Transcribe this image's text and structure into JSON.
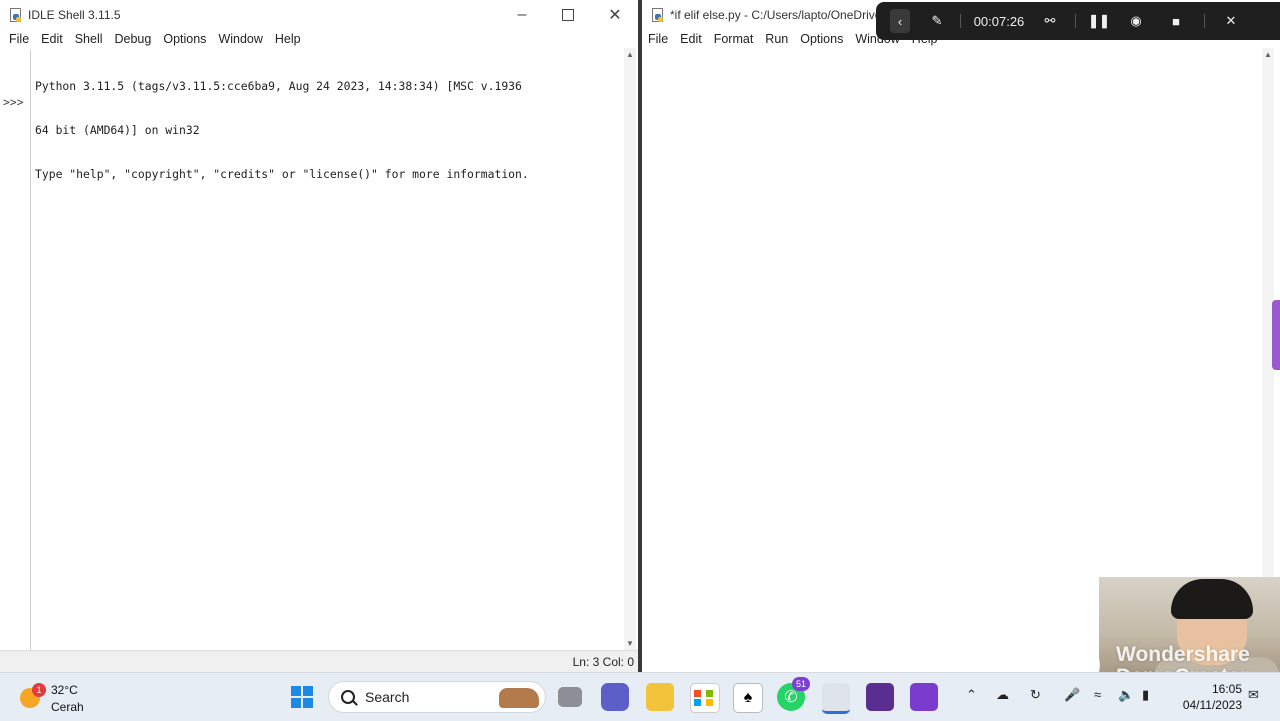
{
  "shell_window": {
    "title": "IDLE Shell 3.11.5",
    "menu": [
      "File",
      "Edit",
      "Shell",
      "Debug",
      "Options",
      "Window",
      "Help"
    ],
    "prompt": ">>>",
    "banner": [
      "Python 3.11.5 (tags/v3.11.5:cce6ba9, Aug 24 2023, 14:38:34) [MSC v.1936",
      "64 bit (AMD64)] on win32",
      "Type \"help\", \"copyright\", \"credits\" or \"license()\" for more information."
    ],
    "status": "Ln: 3   Col: 0",
    "controls": {
      "minimize": "minimize-icon",
      "maximize": "maximize-icon",
      "close": "close-icon"
    }
  },
  "editor_window": {
    "title": "*if elif else.py - C:/Users/lapto/OneDrive",
    "menu": [
      "File",
      "Edit",
      "Format",
      "Run",
      "Options",
      "Window",
      "Help"
    ]
  },
  "recorder": {
    "timer": "00:07:26",
    "icons": [
      "chevron-left-icon",
      "pen-icon",
      "shield-icon",
      "pause-icon",
      "camera-icon",
      "stop-icon",
      "close-icon"
    ]
  },
  "watermark": {
    "line1": "Wondershare",
    "line2": "DemoCreator"
  },
  "taskbar": {
    "weather": {
      "temp": "32°C",
      "condition": "Cerah",
      "badge": "1"
    },
    "search_label": "Search",
    "whatsapp_badge": "51",
    "clock_time": "16:05",
    "clock_date": "04/11/2023"
  },
  "colors": {
    "comment": "#dd0000",
    "string": "#00aa00",
    "keyword": "#ff7700",
    "builtin": "#900090",
    "recorder_bg": "#1f1f1f",
    "taskbar_bg": "#e7edf5"
  }
}
